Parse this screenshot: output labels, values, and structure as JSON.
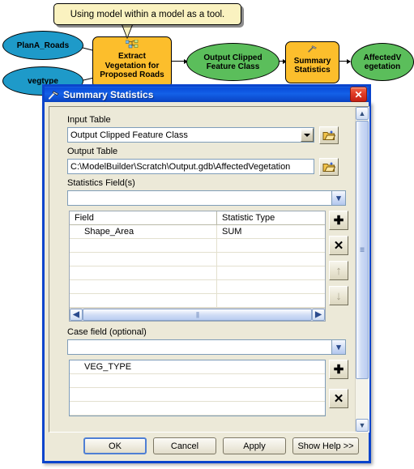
{
  "diagram": {
    "callout": {
      "text": "Using model within a model as a tool."
    },
    "nodes": [
      {
        "id": "plana_roads",
        "label": "PlanA_Roads",
        "shape": "ellipse",
        "color": "#1E9AC9"
      },
      {
        "id": "vegtype",
        "label": "vegtype",
        "shape": "ellipse",
        "color": "#1E9AC9"
      },
      {
        "id": "extract_veg",
        "label": "Extract\nVegetation for\nProposed Roads",
        "shape": "process",
        "color": "#FCBE2C",
        "icon": "model-tool-icon"
      },
      {
        "id": "output_clipped",
        "label": "Output Clipped\nFeature Class",
        "shape": "ellipse",
        "color": "#5BBE5B"
      },
      {
        "id": "summary_statistics",
        "label": "Summary\nStatistics",
        "shape": "process",
        "color": "#FCBE2C",
        "icon": "hammer-tool-icon"
      },
      {
        "id": "affected_vegetation",
        "label": "AffectedV\negetation",
        "shape": "ellipse",
        "color": "#5BBE5B"
      }
    ],
    "node_labels": {
      "plana_roads": "PlanA_Roads",
      "vegtype": "vegtype",
      "extract_l1": "Extract",
      "extract_l2": "Vegetation for",
      "extract_l3": "Proposed Roads",
      "output_l1": "Output Clipped",
      "output_l2": "Feature Class",
      "summary_l1": "Summary",
      "summary_l2": "Statistics",
      "affected_l1": "AffectedV",
      "affected_l2": "egetation"
    }
  },
  "dialog": {
    "title": "Summary Statistics",
    "title_icon": "hammer-tool-icon",
    "close_label": "✕",
    "input_table": {
      "label": "Input Table",
      "value": "Output Clipped Feature Class",
      "browse_icon": "open-folder-icon"
    },
    "output_table": {
      "label": "Output Table",
      "value": "C:\\ModelBuilder\\Scratch\\Output.gdb\\AffectedVegetation",
      "browse_icon": "open-folder-icon"
    },
    "statistics_fields": {
      "label": "Statistics Field(s)",
      "value": "",
      "columns": [
        "Field",
        "Statistic Type"
      ],
      "rows": [
        {
          "field": "Shape_Area",
          "statistic_type": "SUM"
        },
        {
          "field": "",
          "statistic_type": ""
        },
        {
          "field": "",
          "statistic_type": ""
        },
        {
          "field": "",
          "statistic_type": ""
        },
        {
          "field": "",
          "statistic_type": ""
        },
        {
          "field": "",
          "statistic_type": ""
        }
      ],
      "buttons": [
        {
          "name": "add",
          "glyph": "✚",
          "enabled": true
        },
        {
          "name": "delete",
          "glyph": "✕",
          "enabled": true
        },
        {
          "name": "move-up",
          "glyph": "↑",
          "enabled": false
        },
        {
          "name": "move-down",
          "glyph": "↓",
          "enabled": false
        }
      ]
    },
    "case_field": {
      "label": "Case field (optional)",
      "value": "",
      "rows": [
        "VEG_TYPE",
        "",
        "",
        ""
      ],
      "buttons": [
        {
          "name": "add",
          "glyph": "✚",
          "enabled": true
        },
        {
          "name": "delete",
          "glyph": "✕",
          "enabled": true
        }
      ]
    },
    "footer": {
      "ok": "OK",
      "cancel": "Cancel",
      "apply": "Apply",
      "help": "Show Help >>"
    },
    "colors": {
      "titlebar": "#0A4DDB",
      "dialog_face": "#ECE9D8",
      "close_red": "#C41F13",
      "accent_blue": "#7F9DB9"
    }
  }
}
